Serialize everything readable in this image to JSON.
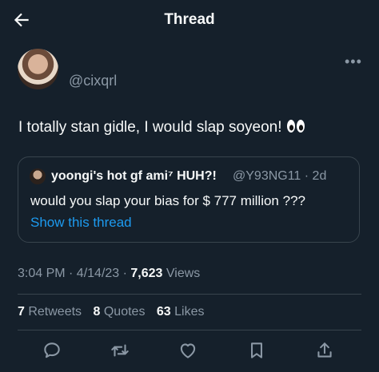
{
  "header": {
    "title": "Thread",
    "back_icon": "arrow-left-icon"
  },
  "tweet": {
    "handle": "@cixqrl",
    "text": "I totally stan gidle, I would slap soyeon!",
    "emoji": "eyes-emoji",
    "timestamp": "3:04 PM · 4/14/23 · ",
    "views_count": "7,623",
    "views_label": " Views"
  },
  "quote": {
    "display_name": "yoongi's hot gf ami⁷ HUH?!",
    "handle_time": "@Y93NG11 · 2d",
    "text": "would you slap your bias for $ 777 million ???",
    "show_thread": "Show this thread"
  },
  "stats": {
    "retweets_count": "7",
    "retweets_label": " Retweets",
    "quotes_count": "8",
    "quotes_label": " Quotes",
    "likes_count": "63",
    "likes_label": " Likes"
  },
  "actions": [
    "reply-icon",
    "retweet-icon",
    "like-icon",
    "bookmark-icon",
    "share-icon"
  ],
  "colors": {
    "background": "#15202b",
    "accent": "#1d9bf0",
    "muted": "#8b98a5",
    "border": "#38444d"
  }
}
